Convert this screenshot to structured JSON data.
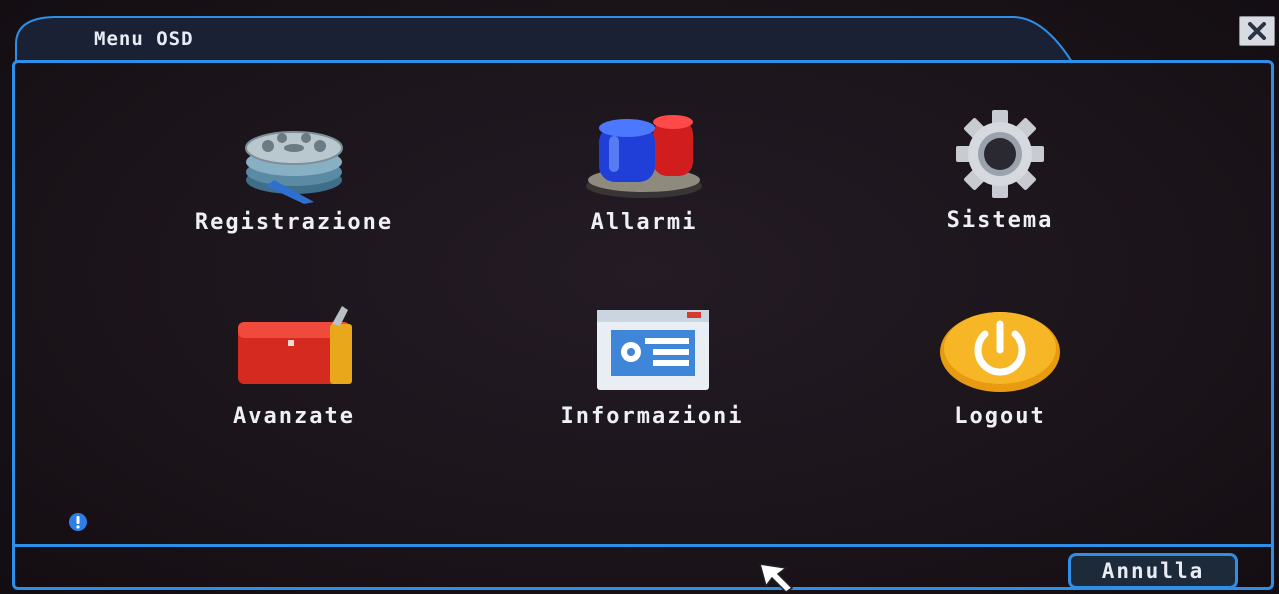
{
  "window": {
    "title": "Menu OSD",
    "close_icon": "close-icon"
  },
  "menu": {
    "items": [
      {
        "label": "Registrazione",
        "icon": "film-reel-icon"
      },
      {
        "label": "Allarmi",
        "icon": "alarm-siren-icon"
      },
      {
        "label": "Sistema",
        "icon": "gear-icon"
      },
      {
        "label": "Avanzate",
        "icon": "toolbox-icon"
      },
      {
        "label": "Informazioni",
        "icon": "info-window-icon"
      },
      {
        "label": "Logout",
        "icon": "power-icon"
      }
    ]
  },
  "footer": {
    "info_icon": "info-icon",
    "cancel_label": "Annulla"
  },
  "colors": {
    "accent": "#2f8fe6",
    "background": "#1b141a",
    "text": "#eef0f6"
  }
}
